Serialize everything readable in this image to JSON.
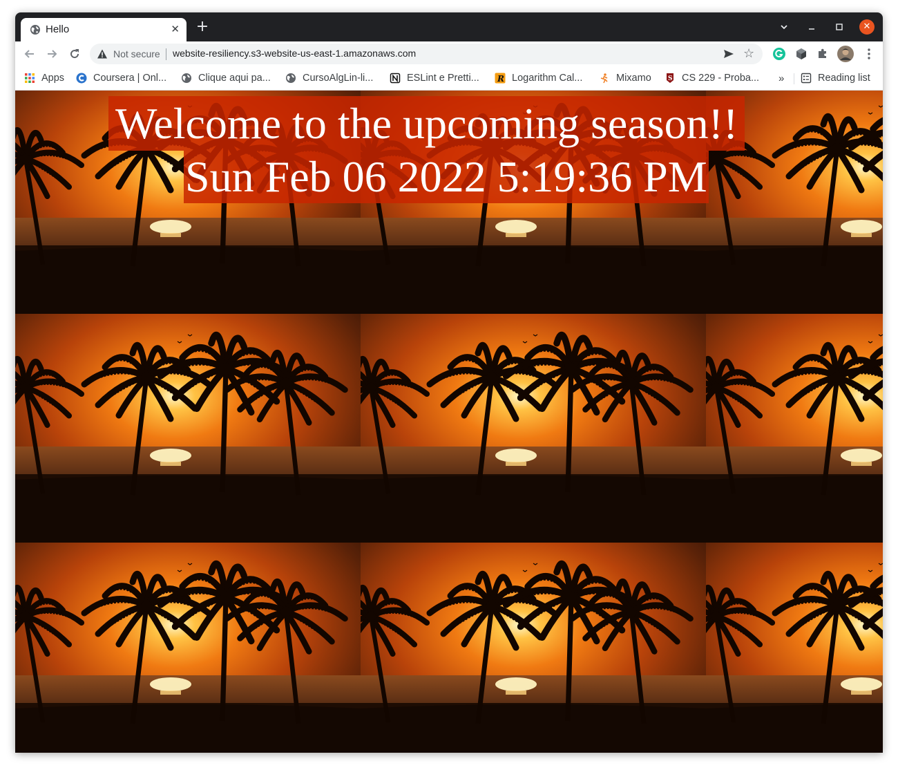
{
  "browser": {
    "tab": {
      "title": "Hello",
      "icon": "globe-icon",
      "close_glyph": "✕"
    },
    "new_tab_glyph": "+",
    "window_controls": {
      "dropdown_glyph": "⌄",
      "minimize_glyph": "–",
      "maximize_glyph": "☐",
      "close_glyph": "✕",
      "close_color": "#e95420"
    },
    "toolbar": {
      "back_glyph": "←",
      "forward_glyph": "→",
      "reload_glyph": "↻",
      "security_label": "Not secure",
      "url": "website-resiliency.s3-website-us-east-1.amazonaws.com",
      "star_glyph": "☆"
    },
    "bookmarks": [
      {
        "label": "Apps",
        "icon": "apps-grid-icon"
      },
      {
        "label": "Coursera | Onl...",
        "icon": "coursera-icon"
      },
      {
        "label": "Clique aqui pa...",
        "icon": "globe-icon"
      },
      {
        "label": "CursoAlgLin-li...",
        "icon": "globe-icon"
      },
      {
        "label": "ESLint e Pretti...",
        "icon": "notion-icon"
      },
      {
        "label": "Logarithm Cal...",
        "icon": "r-logo-icon"
      },
      {
        "label": "Mixamo",
        "icon": "mixamo-icon"
      },
      {
        "label": "CS 229 - Proba...",
        "icon": "stanford-icon"
      }
    ],
    "bookmarks_more": "»",
    "reading_list": "Reading list"
  },
  "page": {
    "headline": "Welcome to the upcoming season!!",
    "datetime": "Sun Feb 06 2022 5:19:36 PM",
    "banner_color": "#c82600",
    "background": "tiled sunset palm-tree beach image"
  }
}
